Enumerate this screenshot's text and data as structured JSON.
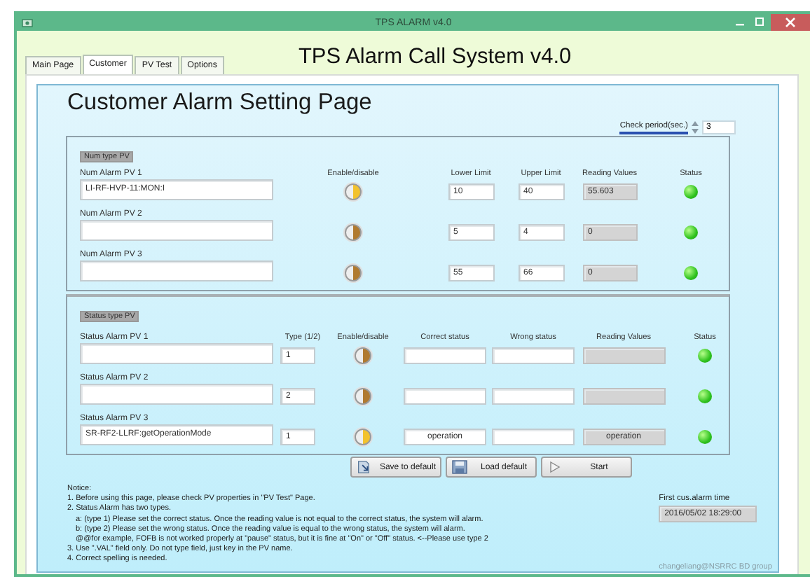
{
  "window": {
    "title": "TPS ALARM v4.0"
  },
  "tabs": [
    {
      "label": "Main Page",
      "selected": false
    },
    {
      "label": "Customer",
      "selected": true
    },
    {
      "label": "PV Test",
      "selected": false
    },
    {
      "label": "Options",
      "selected": false
    }
  ],
  "app_title": "TPS Alarm Call System v4.0",
  "page_title": "Customer Alarm Setting Page",
  "check_period": {
    "label": "Check period(sec.)",
    "value": "3"
  },
  "num_section": {
    "label": "Num type PV",
    "headers": {
      "enable": "Enable/disable",
      "lower": "Lower Limit",
      "upper": "Upper Limit",
      "reading": "Reading Values",
      "status": "Status"
    },
    "rows": [
      {
        "label": "Num Alarm PV 1",
        "pv": "LI-RF-HVP-11:MON:I",
        "enabled": true,
        "lower": "10",
        "upper": "40",
        "reading": "55.603",
        "status_on": true
      },
      {
        "label": "Num Alarm PV 2",
        "enabled": false,
        "lower": "5",
        "upper": "4",
        "reading": "0",
        "status_on": true
      },
      {
        "label": "Num Alarm PV 3",
        "enabled": false,
        "lower": "55",
        "upper": "66",
        "reading": "0",
        "status_on": true
      }
    ]
  },
  "status_section": {
    "label": "Status type PV",
    "headers": {
      "type": "Type (1/2)",
      "enable": "Enable/disable",
      "correct": "Correct status",
      "wrong": "Wrong status",
      "reading": "Reading Values",
      "status": "Status"
    },
    "rows": [
      {
        "label": "Status Alarm PV 1",
        "type": "1",
        "enabled": false,
        "status_on": true
      },
      {
        "label": "Status Alarm PV 2",
        "type": "2",
        "enabled": false,
        "status_on": true
      },
      {
        "label": "Status Alarm PV 3",
        "pv": "SR-RF2-LLRF:getOperationMode",
        "type": "1",
        "enabled": true,
        "correct": "operation",
        "reading": "operation",
        "status_on": true
      }
    ]
  },
  "buttons": [
    {
      "label": "Save to default",
      "kind": "save"
    },
    {
      "label": "Load default",
      "kind": "load"
    },
    {
      "label": "Start",
      "kind": "start"
    }
  ],
  "notice": {
    "heading": "Notice:",
    "items": [
      {
        "text": "1. Before using this page, please check PV properties in \"PV Test\" Page."
      },
      {
        "text": "2. Status Alarm has two types.",
        "children": [
          {
            "text": "a: (type 1) Please set the correct status. Once the reading value is not equal to the correct status, the system will alarm."
          },
          {
            "text": "b: (type 2) Please set the wrong status. Once the reading value is equal to the wrong status, the system will alarm."
          },
          {
            "text": "@@for example, FOFB is not worked properly at \"pause\" status, but it is fine at \"On\" or \"Off\" status. <--Please use type 2"
          }
        ]
      },
      {
        "text": "3. Use \".VAL\" field only.  Do not type field, just key in the PV name."
      },
      {
        "text": "4. Correct spelling is needed."
      }
    ]
  },
  "first_alarm": {
    "label": "First cus.alarm time",
    "value": "2016/05/02 18:29:00"
  },
  "credit": "changeliang@NSRRC BD group"
}
